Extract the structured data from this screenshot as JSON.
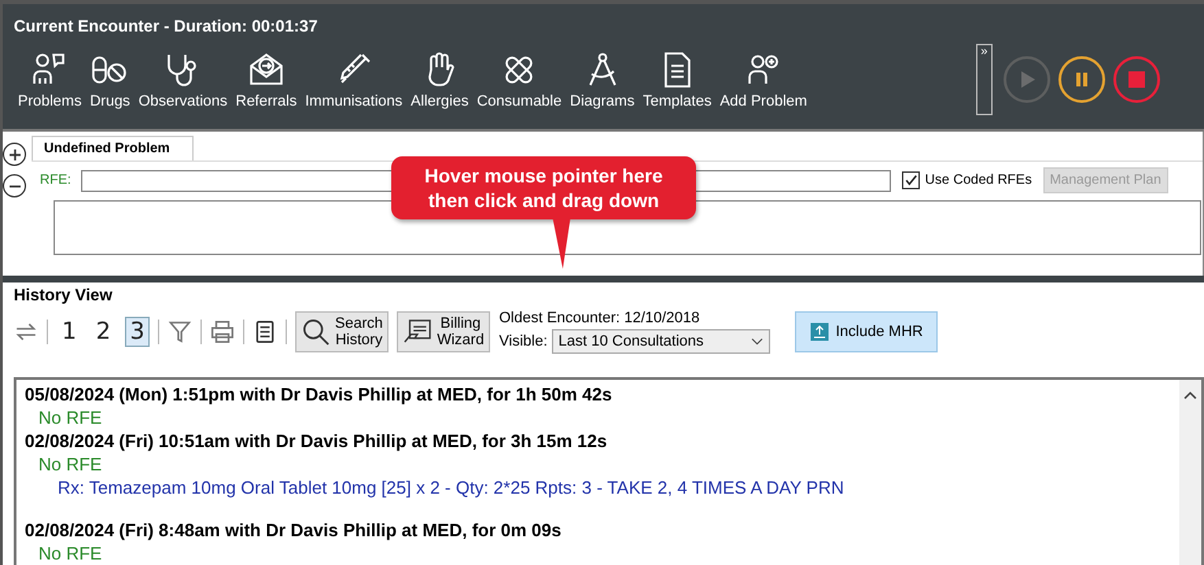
{
  "encounter": {
    "title": "Current Encounter - Duration: 00:01:37"
  },
  "toolbar": [
    {
      "kind": "problems",
      "label": "Problems"
    },
    {
      "kind": "drugs",
      "label": "Drugs"
    },
    {
      "kind": "observations",
      "label": "Observations"
    },
    {
      "kind": "referrals",
      "label": "Referrals"
    },
    {
      "kind": "immunisations",
      "label": "Immunisations"
    },
    {
      "kind": "allergies",
      "label": "Allergies"
    },
    {
      "kind": "consumable",
      "label": "Consumable"
    },
    {
      "kind": "diagrams",
      "label": "Diagrams"
    },
    {
      "kind": "templates",
      "label": "Templates"
    },
    {
      "kind": "add-problem",
      "label": "Add Problem"
    }
  ],
  "overflow": {
    "label": "»"
  },
  "media_controls": [
    {
      "kind": "play",
      "disabled": true
    },
    {
      "kind": "pause",
      "disabled": false
    },
    {
      "kind": "stop",
      "disabled": false
    }
  ],
  "problem": {
    "tab": {
      "label": "Undefined Problem",
      "selected": true
    },
    "rfe_label": "RFE:",
    "use_coded": {
      "label": "Use Coded RFEs",
      "checked": true
    },
    "management_plan": {
      "label": "Management Plan",
      "disabled": true
    }
  },
  "callout": {
    "lines": [
      "Hover mouse pointer here",
      "then click and drag down"
    ]
  },
  "history": {
    "title": "History View",
    "pages": [
      {
        "label": "1",
        "selected": false
      },
      {
        "label": "2",
        "selected": false
      },
      {
        "label": "3",
        "selected": true
      }
    ],
    "search_button": "Search History",
    "billing_button": "Billing Wizard",
    "oldest": "Oldest Encounter: 12/10/2018",
    "visible_label": "Visible:",
    "visible_value": "Last 10 Consultations",
    "include_mhr": "Include MHR",
    "entries": [
      {
        "header": "05/08/2024 (Mon) 1:51pm with Dr Davis Phillip at MED, for 1h 50m 42s",
        "lines": [
          {
            "kind": "rfe",
            "text": "No RFE"
          }
        ]
      },
      {
        "header": "02/08/2024 (Fri) 10:51am with Dr Davis Phillip at MED, for 3h 15m 12s",
        "lines": [
          {
            "kind": "rfe",
            "text": "No RFE"
          },
          {
            "kind": "rx",
            "text": "Rx: Temazepam 10mg Oral Tablet 10mg [25] x 2 - Qty: 2*25 Rpts: 3 - TAKE 2, 4 TIMES A DAY PRN"
          }
        ]
      },
      {
        "header": "02/08/2024 (Fri) 8:48am with Dr Davis Phillip at MED, for 0m 09s",
        "lines": [
          {
            "kind": "rfe",
            "text": "No RFE"
          }
        ]
      }
    ]
  }
}
